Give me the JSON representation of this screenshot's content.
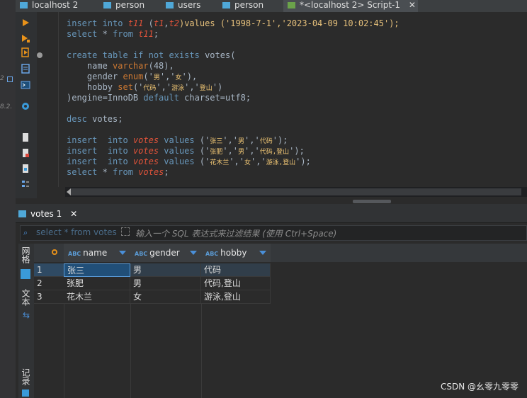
{
  "left_strip": {
    "text1": "2",
    "text2": "8.2."
  },
  "tabs": [
    {
      "label": "localhost 2"
    },
    {
      "label": "person"
    },
    {
      "label": "users"
    },
    {
      "label": "person"
    },
    {
      "label": "*<localhost 2> Script-1",
      "close": "✕"
    }
  ],
  "editor": {
    "lines": {
      "l1": {
        "a": "insert into ",
        "b": "t11",
        "c": " (",
        "d": "t1",
        "e": ",",
        "f": "t2",
        "g": ")values ('1998-7-1','2023-04-09 10:02:45');"
      },
      "l2": {
        "a": "select",
        "b": " * ",
        "c": "from",
        "d": " ",
        "e": "t11",
        "f": ";"
      },
      "l3": {
        "a": "create table if not exists",
        "b": " votes("
      },
      "l4": {
        "a": "    name ",
        "b": "varchar",
        "c": "(48),"
      },
      "l5": {
        "a": "    gender ",
        "b": "enum",
        "c": "('",
        "d": "男",
        "e": "','",
        "f": "女",
        "g": "'),"
      },
      "l6": {
        "a": "    hobby ",
        "b": "set",
        "c": "('",
        "d": "代码",
        "e": "','",
        "f": "游泳",
        "g": "','",
        "h": "登山",
        "i": "')"
      },
      "l7": {
        "a": ")engine=InnoDB ",
        "b": "default",
        "c": " charset=utf8;"
      },
      "l8": {
        "a": "desc",
        "b": " votes;"
      },
      "ins1": {
        "a": "insert  into ",
        "b": "votes",
        "c": " values",
        "d": " ('",
        "e": "张三",
        "f": "','",
        "g": "男",
        "h": "','",
        "i": "代码",
        "j": "');"
      },
      "ins2": {
        "a": "insert  into ",
        "b": "votes",
        "c": " values",
        "d": " ('",
        "e": "张肥",
        "f": "','",
        "g": "男",
        "h": "','",
        "i": "代码,登山",
        "j": "');"
      },
      "ins3": {
        "a": "insert  into ",
        "b": "votes",
        "c": " values",
        "d": " ('",
        "e": "花木兰",
        "f": "','",
        "g": "女",
        "h": "','",
        "i": "游泳,登山",
        "j": "');"
      },
      "l9": {
        "a": "select",
        "b": " * ",
        "c": "from",
        "d": " ",
        "e": "votes",
        "f": ";"
      }
    }
  },
  "results": {
    "tab_label": "votes 1",
    "tab_close": "✕",
    "filter": {
      "query_placeholder": "select * from votes",
      "hint": "输入一个 SQL 表达式来过滤结果 (使用 Ctrl+Space)"
    },
    "side_tabs": {
      "grid": "网格",
      "text": "文本",
      "record": "记录"
    },
    "columns": [
      {
        "type": "ABC",
        "name": "name"
      },
      {
        "type": "ABC",
        "name": "gender"
      },
      {
        "type": "ABC",
        "name": "hobby"
      }
    ],
    "rows": [
      {
        "num": "1",
        "name": "张三",
        "gender": "男",
        "hobby": "代码"
      },
      {
        "num": "2",
        "name": "张肥",
        "gender": "男",
        "hobby": "代码,登山"
      },
      {
        "num": "3",
        "name": "花木兰",
        "gender": "女",
        "hobby": "游泳,登山"
      }
    ]
  },
  "watermark": "CSDN @幺零九零零",
  "colors": {
    "keyword": "#6897bb",
    "table_name": "#e0533a",
    "string": "#e6c07b",
    "accent": "#4a8fd8"
  }
}
